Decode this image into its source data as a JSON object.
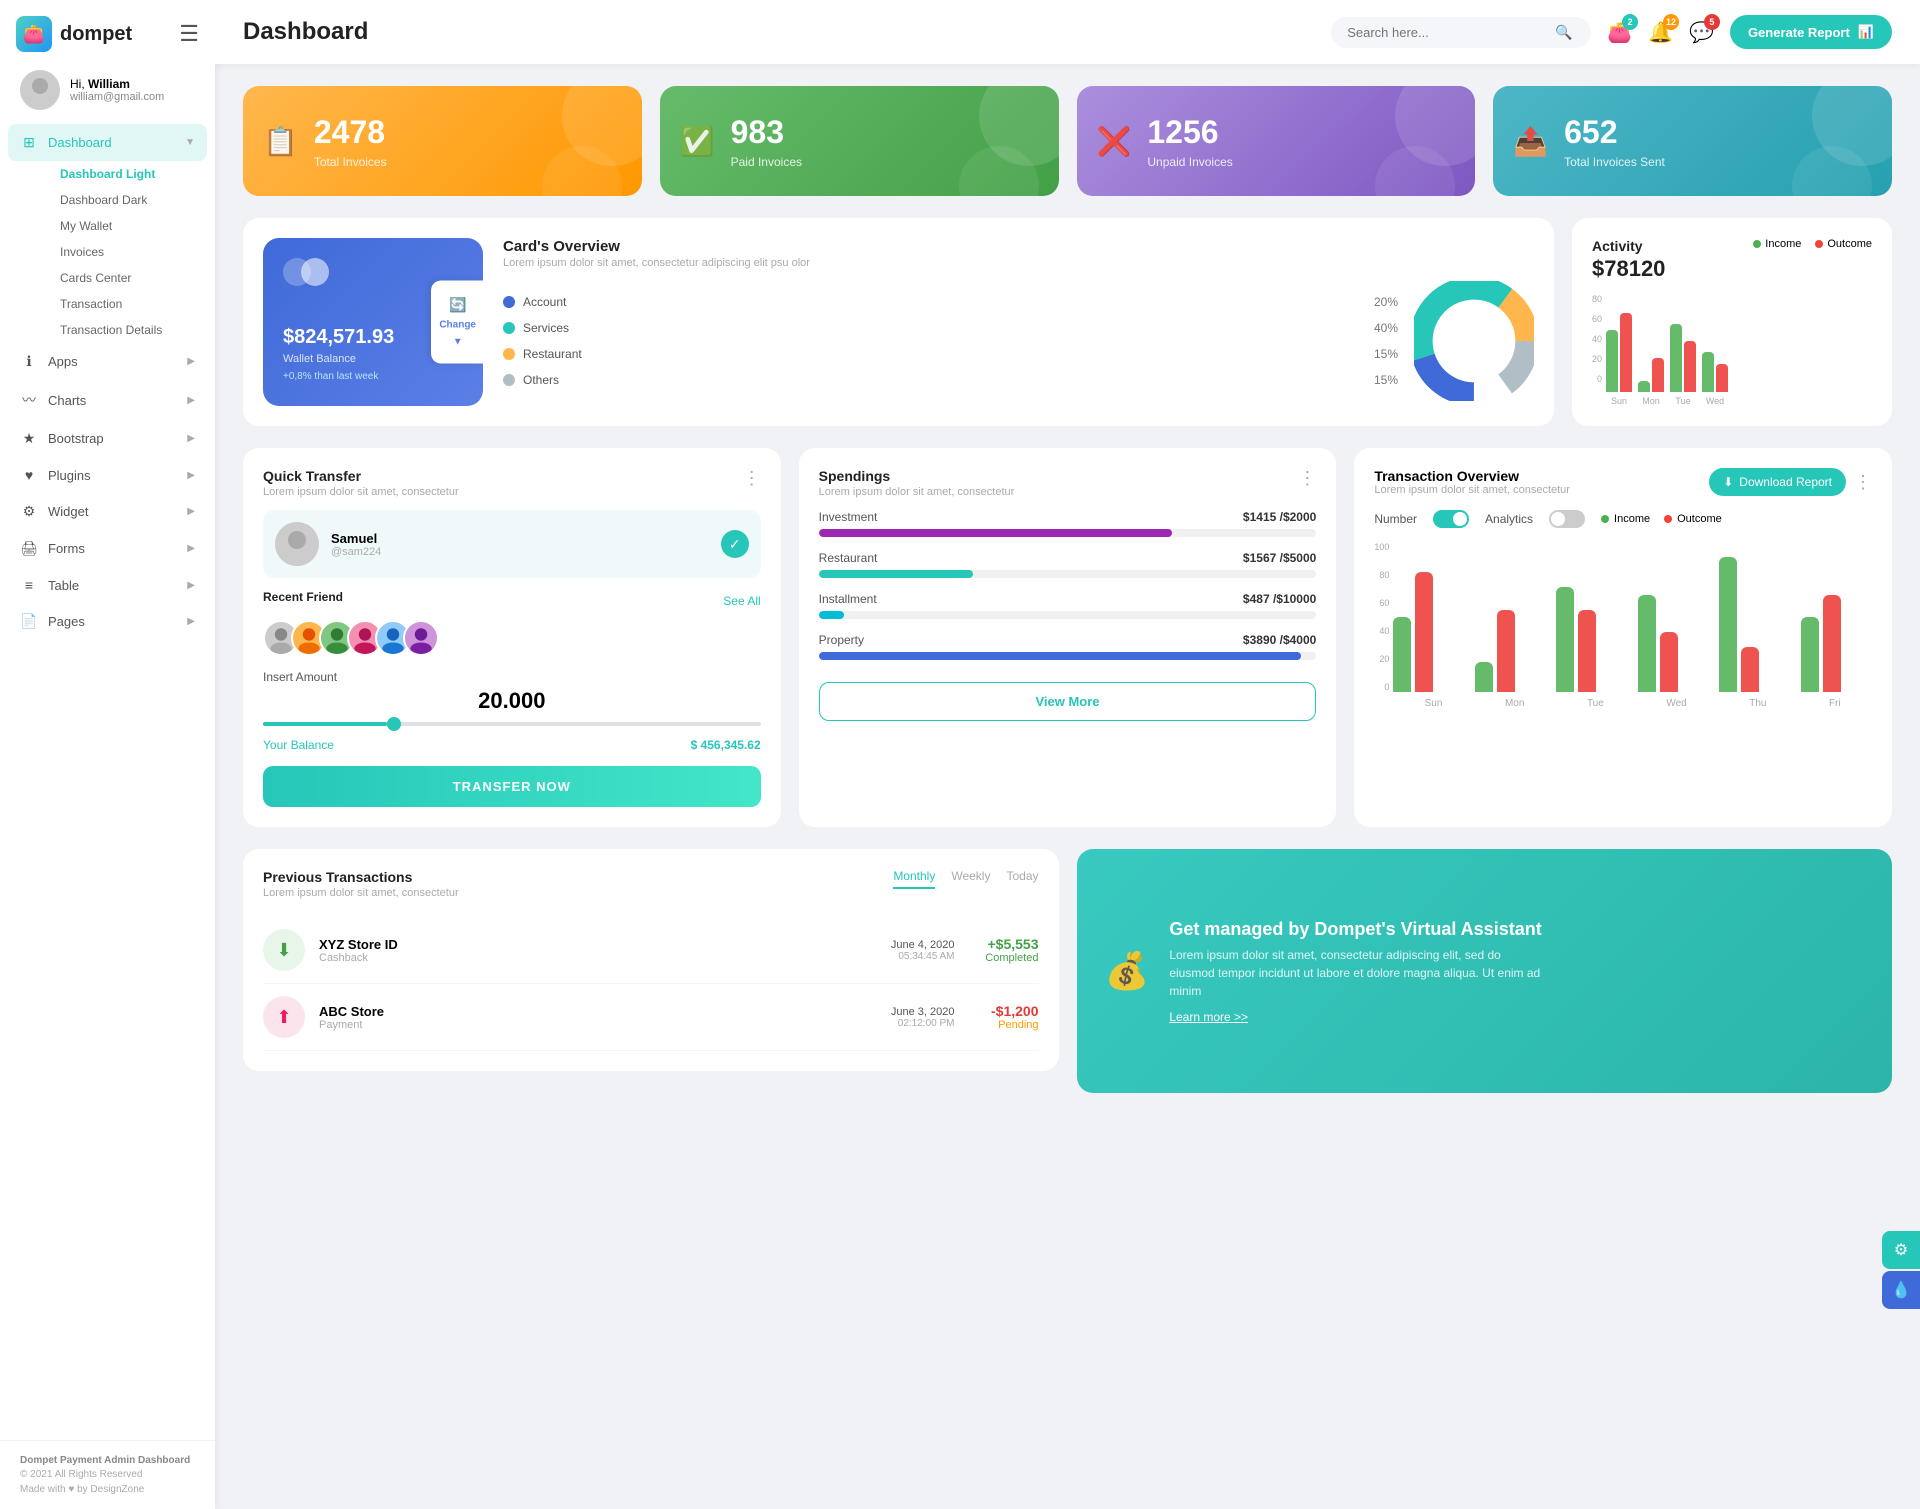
{
  "app": {
    "name": "dompet",
    "logo_emoji": "👛"
  },
  "user": {
    "greeting": "Hi,",
    "name": "William",
    "email": "william@gmail.com",
    "avatar_emoji": "👤"
  },
  "header": {
    "title": "Dashboard",
    "search_placeholder": "Search here...",
    "generate_btn": "Generate Report",
    "badges": {
      "wallet": "2",
      "bell": "12",
      "chat": "5"
    }
  },
  "stat_cards": [
    {
      "value": "2478",
      "label": "Total Invoices",
      "color": "orange",
      "icon": "📋"
    },
    {
      "value": "983",
      "label": "Paid Invoices",
      "color": "green",
      "icon": "✅"
    },
    {
      "value": "1256",
      "label": "Unpaid Invoices",
      "color": "purple",
      "icon": "❌"
    },
    {
      "value": "652",
      "label": "Total Invoices Sent",
      "color": "teal",
      "icon": "📤"
    }
  ],
  "cards_overview": {
    "title": "Card's Overview",
    "subtitle": "Lorem ipsum dolor sit amet, consectetur adipiscing elit psu olor",
    "wallet_amount": "$824,571.93",
    "wallet_label": "Wallet Balance",
    "wallet_change": "+0,8% than last week",
    "change_btn": "Change",
    "legend": [
      {
        "label": "Account",
        "pct": "20%",
        "color": "#3f6ad8"
      },
      {
        "label": "Services",
        "pct": "40%",
        "color": "#26c6b9"
      },
      {
        "label": "Restaurant",
        "pct": "15%",
        "color": "#ffb74d"
      },
      {
        "label": "Others",
        "pct": "15%",
        "color": "#b0bec5"
      }
    ]
  },
  "activity": {
    "title": "Activity",
    "amount": "$78120",
    "legend_income": "Income",
    "legend_outcome": "Outcome",
    "bars": [
      {
        "day": "Sun",
        "income": 55,
        "outcome": 70
      },
      {
        "day": "Mon",
        "income": 10,
        "outcome": 30
      },
      {
        "day": "Tue",
        "income": 60,
        "outcome": 45
      },
      {
        "day": "Wed",
        "income": 35,
        "outcome": 25
      }
    ],
    "y_labels": [
      "80",
      "60",
      "40",
      "20",
      "0"
    ]
  },
  "quick_transfer": {
    "title": "Quick Transfer",
    "subtitle": "Lorem ipsum dolor sit amet, consectetur",
    "selected_name": "Samuel",
    "selected_handle": "@sam224",
    "recent_label": "Recent Friend",
    "see_all": "See All",
    "amount_label": "Insert Amount",
    "amount_value": "20.000",
    "balance_label": "Your Balance",
    "balance_value": "$ 456,345.62",
    "transfer_btn": "TRANSFER NOW",
    "friends": [
      "👨",
      "👩",
      "👦",
      "👧",
      "👱",
      "👩‍🦱"
    ]
  },
  "spendings": {
    "title": "Spendings",
    "subtitle": "Lorem ipsum dolor sit amet, consectetur",
    "items": [
      {
        "label": "Investment",
        "amount": "$1415",
        "max": "$2000",
        "pct": 71,
        "color": "#9c27b0"
      },
      {
        "label": "Restaurant",
        "amount": "$1567",
        "max": "$5000",
        "pct": 31,
        "color": "#26c6b9"
      },
      {
        "label": "Installment",
        "amount": "$487",
        "max": "$10000",
        "pct": 5,
        "color": "#00bcd4"
      },
      {
        "label": "Property",
        "amount": "$3890",
        "max": "$4000",
        "pct": 97,
        "color": "#3f6ad8"
      }
    ],
    "view_more_btn": "View More"
  },
  "transaction_overview": {
    "title": "Transaction Overview",
    "subtitle": "Lorem ipsum dolor sit amet, consectetur",
    "download_btn": "Download Report",
    "toggle_number": "Number",
    "toggle_analytics": "Analytics",
    "legend_income": "Income",
    "legend_outcome": "Outcome",
    "bars": [
      {
        "day": "Sun",
        "income": 50,
        "outcome": 80
      },
      {
        "day": "Mon",
        "income": 20,
        "outcome": 55
      },
      {
        "day": "Tue",
        "income": 70,
        "outcome": 55
      },
      {
        "day": "Wed",
        "income": 65,
        "outcome": 40
      },
      {
        "day": "Thu",
        "income": 90,
        "outcome": 30
      },
      {
        "day": "Fri",
        "income": 50,
        "outcome": 65
      }
    ],
    "y_labels": [
      "100",
      "80",
      "60",
      "40",
      "20",
      "0"
    ]
  },
  "prev_transactions": {
    "title": "Previous Transactions",
    "subtitle": "Lorem ipsum dolor sit amet, consectetur",
    "periods": [
      "Monthly",
      "Weekly",
      "Today"
    ],
    "active_period": "Monthly",
    "items": [
      {
        "name": "XYZ Store ID",
        "type": "Cashback",
        "date": "June 4, 2020",
        "time": "05:34:45 AM",
        "amount": "+$5,553",
        "status": "Completed",
        "icon": "⬇",
        "icon_type": "green"
      },
      {
        "name": "ABC Store",
        "type": "Payment",
        "date": "June 3, 2020",
        "time": "02:12:00 PM",
        "amount": "-$1,200",
        "status": "Pending",
        "icon": "⬆",
        "icon_type": "pink"
      }
    ]
  },
  "va_banner": {
    "title": "Get managed by Dompet's Virtual Assistant",
    "desc": "Lorem ipsum dolor sit amet, consectetur adipiscing elit, sed do eiusmod tempor incidunt ut labore et dolore magna aliqua. Ut enim ad minim",
    "link": "Learn more >>",
    "icon": "💰"
  },
  "sidebar": {
    "nav_main": [
      {
        "id": "apps",
        "label": "Apps",
        "icon": "ℹ",
        "has_sub": true
      },
      {
        "id": "charts",
        "label": "Charts",
        "icon": "〰",
        "has_sub": true
      },
      {
        "id": "bootstrap",
        "label": "Bootstrap",
        "icon": "★",
        "has_sub": true
      },
      {
        "id": "plugins",
        "label": "Plugins",
        "icon": "♥",
        "has_sub": true
      },
      {
        "id": "widget",
        "label": "Widget",
        "icon": "⚙",
        "has_sub": true
      },
      {
        "id": "forms",
        "label": "Forms",
        "icon": "🖨",
        "has_sub": true
      },
      {
        "id": "table",
        "label": "Table",
        "icon": "≡",
        "has_sub": true
      },
      {
        "id": "pages",
        "label": "Pages",
        "icon": "📄",
        "has_sub": true
      }
    ],
    "dashboard_sub": [
      "Dashboard Light",
      "Dashboard Dark",
      "My Wallet",
      "Invoices",
      "Cards Center",
      "Transaction",
      "Transaction Details"
    ],
    "footer_title": "Dompet Payment Admin Dashboard",
    "footer_copy": "© 2021 All Rights Reserved",
    "footer_made": "Made with ♥ by DesignZone"
  }
}
